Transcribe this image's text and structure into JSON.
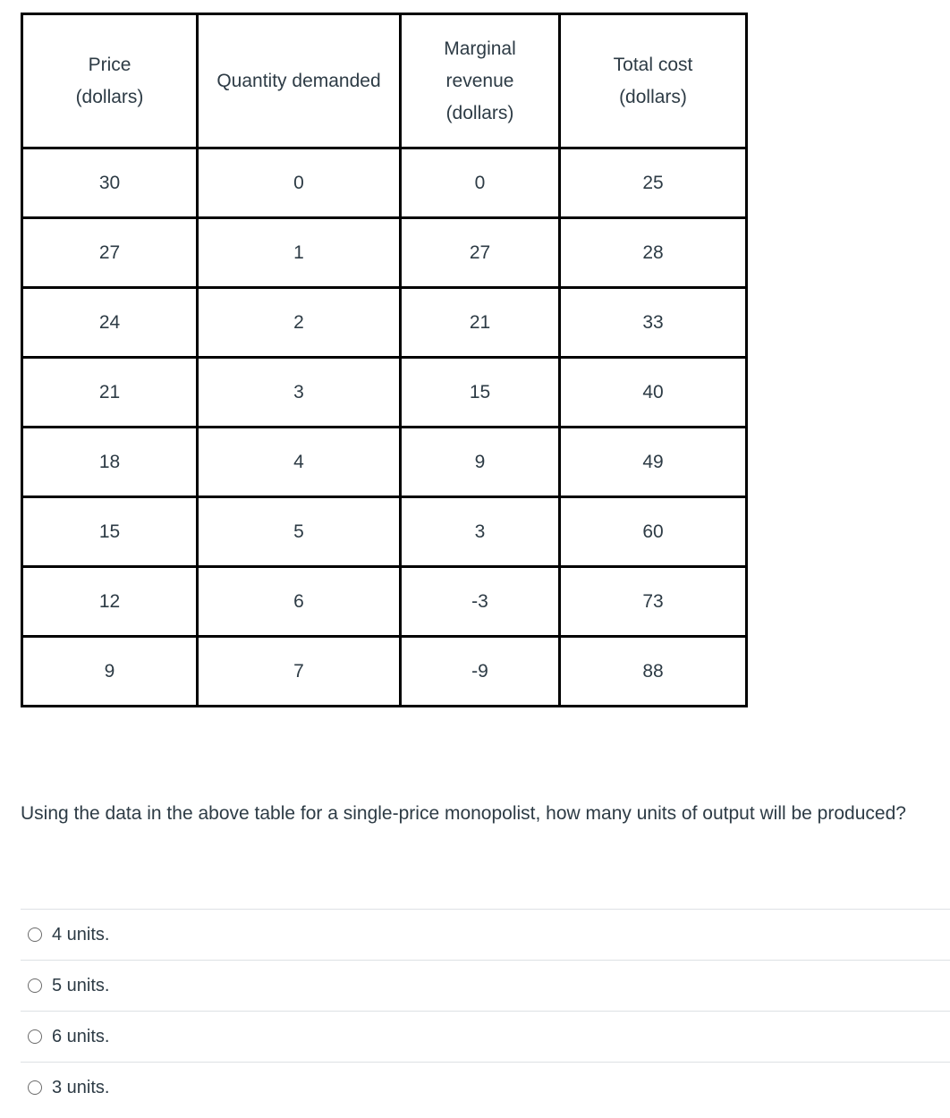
{
  "table": {
    "headers": [
      [
        "Price",
        "(dollars)"
      ],
      [
        "Quantity demanded"
      ],
      [
        "Marginal",
        "revenue",
        "(dollars)"
      ],
      [
        "Total cost",
        "(dollars)"
      ]
    ],
    "rows": [
      [
        "30",
        "0",
        "0",
        "25"
      ],
      [
        "27",
        "1",
        "27",
        "28"
      ],
      [
        "24",
        "2",
        "21",
        "33"
      ],
      [
        "21",
        "3",
        "15",
        "40"
      ],
      [
        "18",
        "4",
        "9",
        "49"
      ],
      [
        "15",
        "5",
        "3",
        "60"
      ],
      [
        "12",
        "6",
        "-3",
        "73"
      ],
      [
        "9",
        "7",
        "-9",
        "88"
      ]
    ]
  },
  "question": {
    "text": "Using the data in the above table for a single-price monopolist, how many units of output will be produced?"
  },
  "answers": [
    {
      "label": "4 units.",
      "selected": false
    },
    {
      "label": "5 units.",
      "selected": false
    },
    {
      "label": "6 units.",
      "selected": false
    },
    {
      "label": "3 units.",
      "selected": false
    }
  ]
}
